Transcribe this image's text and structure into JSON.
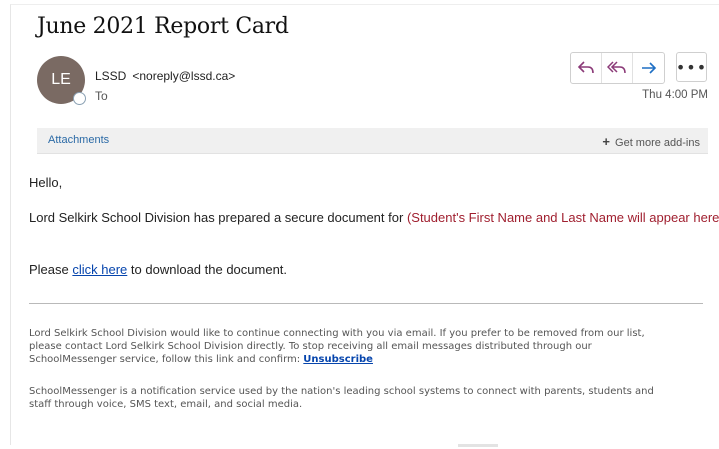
{
  "email": {
    "subject": "June 2021 Report Card",
    "sender_initials": "LE",
    "sender_name": "LSSD",
    "sender_email": "<noreply@lssd.ca>",
    "to_label": "To",
    "timestamp": "Thu 4:00 PM"
  },
  "actions": {
    "reply_icon": "reply-icon",
    "reply_all_icon": "reply-all-icon",
    "forward_icon": "forward-icon",
    "more_icon": "more-icon"
  },
  "attachments_bar": {
    "attachments_label": "Attachments",
    "add_ins_label": "Get more add-ins"
  },
  "body": {
    "greeting": "Hello,",
    "line1_text": "Lord Selkirk School Division has prepared a secure document for",
    "line1_placeholder": "(Student's First Name and Last Name will appear here)",
    "line2_before": "Please",
    "line2_link": "click here",
    "line2_after": "to download the document."
  },
  "footer": {
    "para1_line1": "Lord Selkirk School Division would like to continue connecting with you via email. If you prefer to be removed from our list,",
    "para1_line2": "please contact Lord Selkirk School Division directly. To stop receiving all email messages distributed through our",
    "para1_line3": "SchoolMessenger service, follow this link and confirm:",
    "unsubscribe_link": "Unsubscribe",
    "para2_line1": "SchoolMessenger is a notification service used by the nation's leading school systems to connect with parents, students and",
    "para2_line2": "staff through voice, SMS text, email, and social media."
  },
  "colors": {
    "avatar": "#7a6a63",
    "reply_accent": "#8b3a78",
    "forward_accent": "#1e6fc4",
    "placeholder_text": "#a01f2f",
    "link": "#0645ad"
  }
}
